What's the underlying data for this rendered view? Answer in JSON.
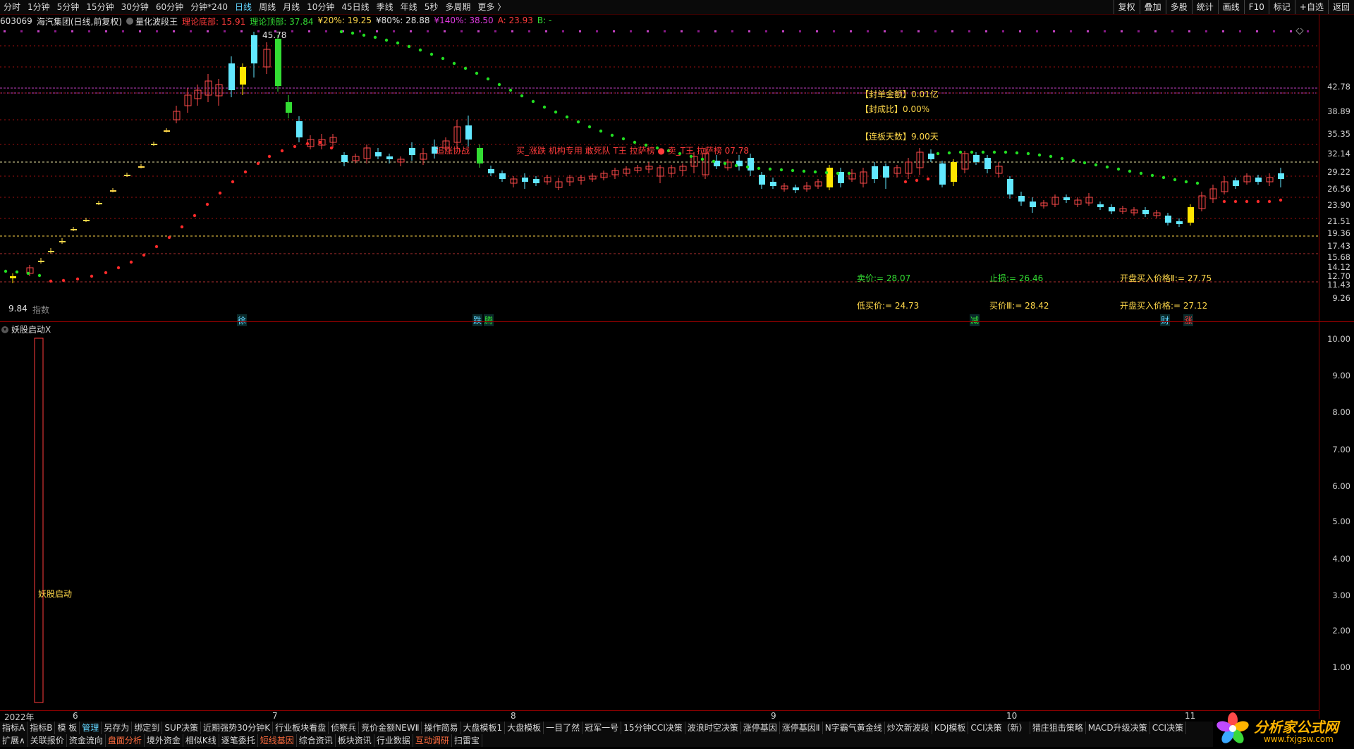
{
  "topbar": {
    "tabs": [
      "分时",
      "1分钟",
      "5分钟",
      "15分钟",
      "30分钟",
      "60分钟",
      "分钟*240",
      "日线",
      "周线",
      "月线",
      "10分钟",
      "45日线",
      "季线",
      "年线",
      "5秒",
      "多周期",
      "更多 〉"
    ],
    "active_tab": "日线",
    "right_buttons": [
      "复权",
      "叠加",
      "多股",
      "统计",
      "画线",
      "F10",
      "标记",
      "+自选",
      "返回"
    ]
  },
  "info": {
    "code": "603069",
    "name": "海汽集团",
    "mode": "(日线,前复权)",
    "indicator": "量化波段王",
    "items": [
      {
        "text": "理论底部: 15.91",
        "color": "#ff3b3b"
      },
      {
        "text": "理论顶部: 37.84",
        "color": "#33dd33"
      },
      {
        "text": "¥20%: 19.25",
        "color": "#ffd84a"
      },
      {
        "text": "¥80%: 28.88",
        "color": "#e0e0e0"
      },
      {
        "text": "¥140%: 38.50",
        "color": "#e03ae0"
      },
      {
        "text": "A: 23.93",
        "color": "#ff3b3b"
      },
      {
        "text": "B: -",
        "color": "#33dd33"
      }
    ]
  },
  "price_axis": [
    "42.78",
    "38.89",
    "35.35",
    "32.14",
    "29.22",
    "26.56",
    "23.90",
    "21.51",
    "19.36",
    "17.43",
    "15.68",
    "14.12",
    "12.70",
    "11.43",
    "9.26"
  ],
  "sub_axis": [
    "10.00",
    "9.00",
    "8.00",
    "7.00",
    "6.00",
    "5.00",
    "4.00",
    "3.00",
    "2.00",
    "1.00"
  ],
  "annotations": {
    "high_label": "45.78",
    "low_label": "9.84",
    "left_tag": "指数",
    "fengdan": "【封单金额】0.01亿",
    "fengcheng": "【封成比】0.00%",
    "lianban": "【连板天数】9.00天",
    "red_text": "买_涨跌 机构专用 敢死队 T王 拉萨榜 ● 卖_T王 拉萨榜  07.78",
    "red_text2": "追涨协战",
    "sell_price": "卖价:= 28.07",
    "stop_loss": "止损:= 26.46",
    "open_buy2": "开盘买入价格Ⅱ:= 27.75",
    "low_buy": "低买价:= 24.73",
    "buy3": "买价Ⅲ:= 28.42",
    "open_buy": "开盘买入价格:= 27.12"
  },
  "markers": [
    {
      "text": "徐",
      "color": "#62d5ff"
    },
    {
      "text": "跌",
      "color": "#62d5ff"
    },
    {
      "text": "腾",
      "color": "#33dd33"
    },
    {
      "text": "减",
      "color": "#33dd33"
    },
    {
      "text": "财",
      "color": "#62d5ff"
    },
    {
      "text": "涨",
      "color": "#ff3b3b"
    }
  ],
  "subpane": {
    "title": "妖股启动X",
    "label": "妖股启动"
  },
  "xaxis": [
    "2022年",
    "6",
    "7",
    "8",
    "9",
    "10",
    "11"
  ],
  "tabs_row1": [
    "指标A",
    "指标B",
    "模 板",
    "管理",
    "另存为",
    "绑定到",
    "SUP决策",
    "近期强势30分钟K",
    "行业板块看盘",
    "侦察兵",
    "竞价金额NEWⅡ",
    "操作简易",
    "大盘模板1",
    "大盘模板",
    "一目了然",
    "冠军一号",
    "15分钟CCI决策",
    "波浪时空决策",
    "涨停基因",
    "涨停基因Ⅱ",
    "N字霸气黄金线",
    "炒次新波段",
    "KDJ模板",
    "CCI决策（新）",
    "猎庄狙击策略",
    "MACD升级决策",
    "CCI决策"
  ],
  "tabs_row1_active": "管理",
  "tabs_row2": [
    "扩展∧",
    "关联报价",
    "资金流向",
    "盘面分析",
    "境外资金",
    "相似K线",
    "逐笔委托",
    "短线基因",
    "综合资讯",
    "板块资讯",
    "行业数据",
    "互动调研",
    "扫雷宝"
  ],
  "tabs_row2_active": [
    "盘面分析",
    "短线基因",
    "互动调研"
  ],
  "logo": {
    "text": "分析家公式网",
    "url": "www.fxjgsw.com"
  }
}
